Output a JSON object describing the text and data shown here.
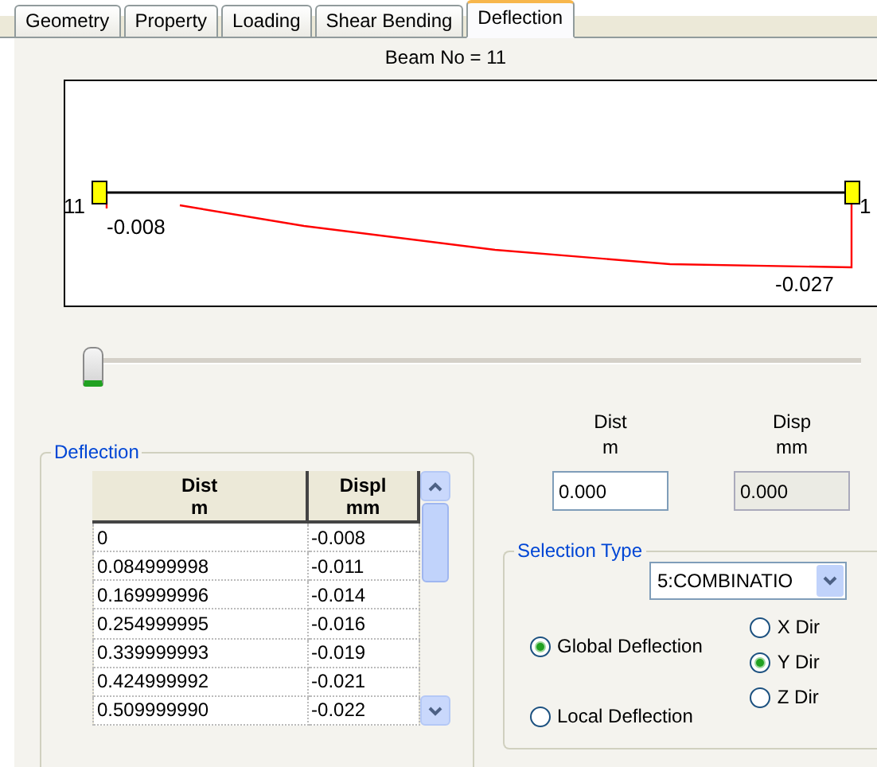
{
  "tabs": [
    {
      "label": "Geometry",
      "selected": false
    },
    {
      "label": "Property",
      "selected": false
    },
    {
      "label": "Loading",
      "selected": false
    },
    {
      "label": "Shear Bending",
      "selected": false
    },
    {
      "label": "Deflection",
      "selected": true
    }
  ],
  "beam_title": "Beam No = 11",
  "diagram": {
    "start_node": "11",
    "end_node": "1",
    "start_value": "-0.008",
    "end_value": "-0.027"
  },
  "slider": {
    "level": 0
  },
  "deflection_group": {
    "title": "Deflection",
    "columns": [
      {
        "title": "Dist",
        "unit": "m"
      },
      {
        "title": "Displ",
        "unit": "mm"
      }
    ],
    "rows": [
      [
        "0",
        "-0.008"
      ],
      [
        "0.084999998",
        "-0.011"
      ],
      [
        "0.169999996",
        "-0.014"
      ],
      [
        "0.254999995",
        "-0.016"
      ],
      [
        "0.339999993",
        "-0.019"
      ],
      [
        "0.424999992",
        "-0.021"
      ],
      [
        "0.509999990",
        "-0.022"
      ]
    ]
  },
  "readouts": [
    {
      "title": "Dist",
      "unit": "m",
      "value": "0.000",
      "disabled": false
    },
    {
      "title": "Disp",
      "unit": "mm",
      "value": "0.000",
      "disabled": true
    }
  ],
  "selection_group": {
    "title": "Selection Type",
    "dropdown": "5:COMBINATIO",
    "types": [
      {
        "label": "Global Deflection",
        "selected": true
      },
      {
        "label": "Local Deflection",
        "selected": false
      }
    ],
    "directions": [
      {
        "label": "X Dir",
        "selected": false
      },
      {
        "label": "Y Dir",
        "selected": true
      },
      {
        "label": "Z Dir",
        "selected": false
      }
    ]
  }
}
